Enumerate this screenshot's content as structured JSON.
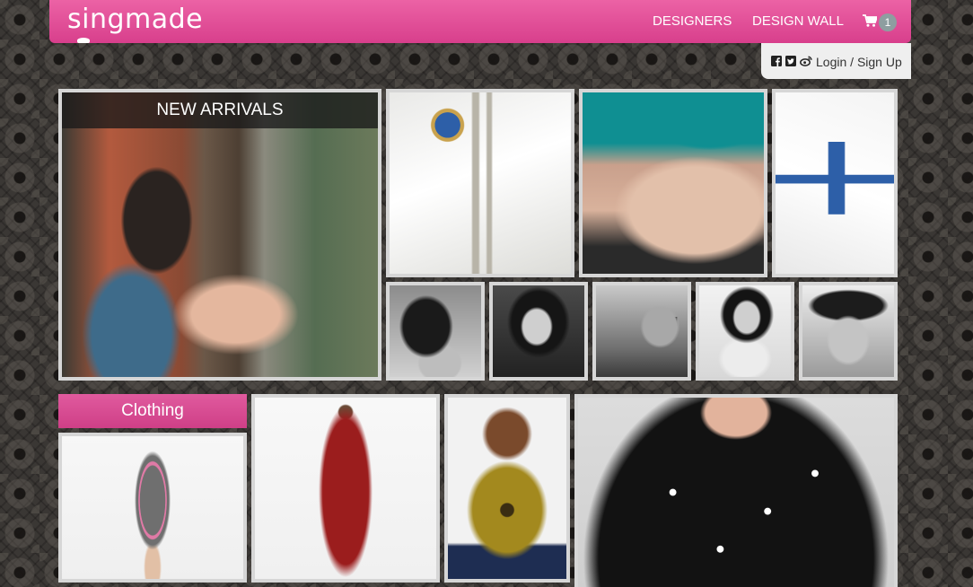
{
  "header": {
    "logo": "singmade",
    "nav": [
      "DESIGNERS",
      "DESIGN WALL"
    ],
    "cart_count": "1",
    "cart_icon": "shopping-cart-icon"
  },
  "account": {
    "social_icons": [
      "facebook-icon",
      "twitter-icon",
      "weibo-icon"
    ],
    "login_label": "Login",
    "separator": "/",
    "signup_label": "Sign Up"
  },
  "sections": {
    "new_arrivals_title": "NEW ARRIVALS",
    "clothing_title": "Clothing"
  },
  "colors": {
    "brand_pink": "#e0509a",
    "badge_gray": "#8e9ea0",
    "tile_border": "#d6d6d6"
  }
}
